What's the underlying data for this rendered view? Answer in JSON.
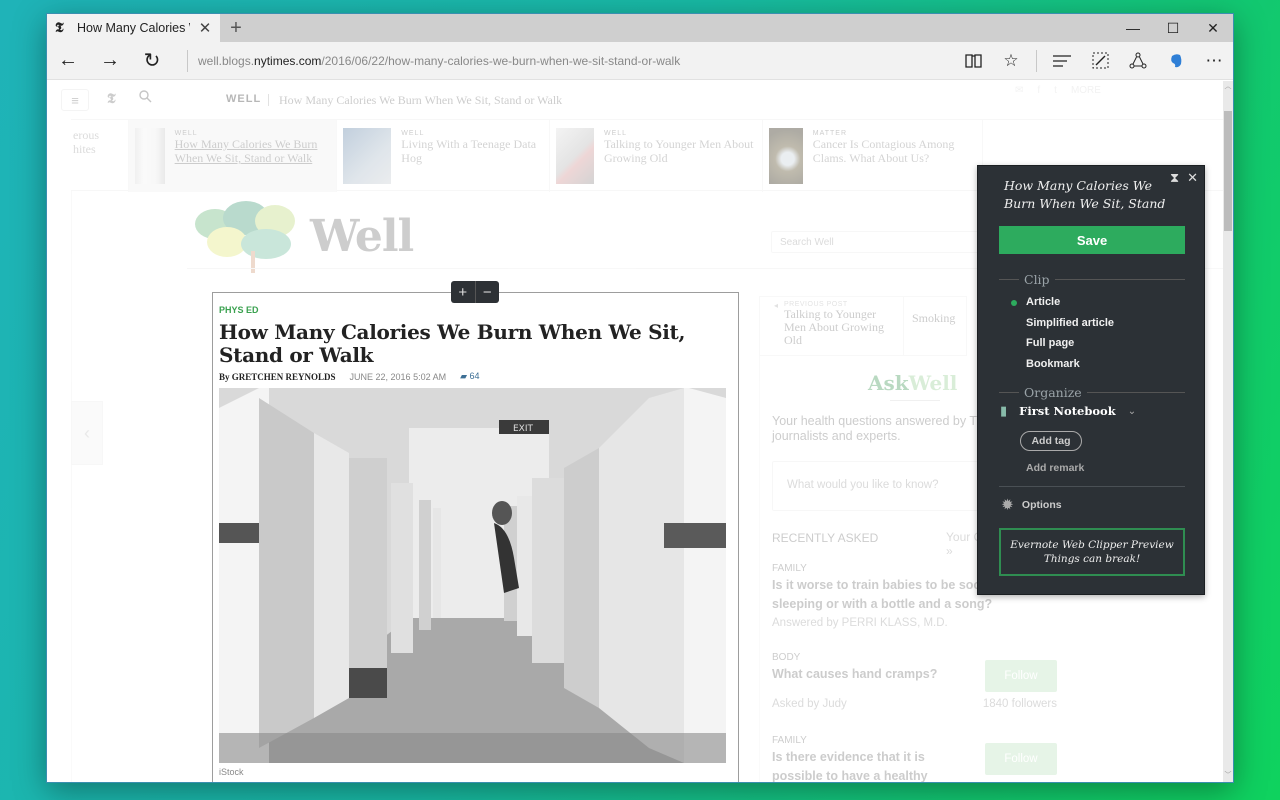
{
  "browser": {
    "tab_title": "How Many Calories We",
    "tab_favicon": "nyt-logo-icon",
    "new_tab": "+",
    "window_controls": {
      "minimize": "—",
      "maximize": "☐",
      "close": "✕"
    },
    "url": {
      "prefix": "well.blogs.",
      "domain": "nytimes.com",
      "path": "/2016/06/22/how-many-calories-we-burn-when-we-sit-stand-or-walk"
    },
    "nav": {
      "back": "←",
      "forward": "→",
      "refresh": "↻"
    },
    "toolbar": {
      "reading_view": "📖",
      "favorite": "☆",
      "hub": "≡",
      "web_note": "✎",
      "share": "⟁",
      "evernote": "🐘",
      "more": "⋯"
    }
  },
  "page": {
    "header": {
      "menu": "≡",
      "logo": "𝕿",
      "search": "🔍",
      "section": "WELL",
      "title": "How Many Calories We Burn When We Sit, Stand or Walk"
    },
    "ribbon": [
      {
        "kicker": "",
        "title": "erous\nhites",
        "current": false
      },
      {
        "kicker": "WELL",
        "title": "How Many Calories We Burn When We Sit, Stand or Walk",
        "current": true
      },
      {
        "kicker": "WELL",
        "title": "Living With a Teenage Data Hog",
        "current": false
      },
      {
        "kicker": "WELL",
        "title": "Talking to Younger Men About Growing Old",
        "current": false
      },
      {
        "kicker": "MATTER",
        "title": "Cancer Is Contagious Among Clams. What About Us?",
        "current": false
      }
    ],
    "share": {
      "more": "MORE"
    },
    "blog_logo": "Well",
    "search_placeholder": "Search Well",
    "prev_post": {
      "label": "PREVIOUS POST",
      "title": "Talking to Younger Men About Growing Old",
      "next_title": "Smoking"
    },
    "article": {
      "kicker": "PHYS ED",
      "title": "How Many Calories We Burn When We Sit, Stand or Walk",
      "byline": "By GRETCHEN REYNOLDS",
      "date": "JUNE 22, 2016 5:02 AM",
      "comments": "64",
      "photo_credit": "iStock",
      "photo_sign": "EXIT"
    },
    "zoom_controls": {
      "plus": "+",
      "minus": "−"
    },
    "askwell": {
      "logo_a": "Ask",
      "logo_b": "Well",
      "intro": "Your health questions answered by Times journalists and experts.",
      "ask_placeholder": "What would you like to know?",
      "recently_asked": "RECENTLY ASKED",
      "your_questions": "Your Questions | All »",
      "questions": [
        {
          "category": "FAMILY",
          "question": "Is it worse to train babies to be soothed by co-sleeping or with a bottle and a song?",
          "meta": "Answered by PERRI KLASS, M.D."
        },
        {
          "category": "BODY",
          "question": "What causes hand cramps?",
          "meta": "Asked by Judy",
          "follow": "Follow",
          "followers": "1840 followers"
        },
        {
          "category": "FAMILY",
          "question": "Is there evidence that it is possible to have a healthy",
          "follow": "Follow"
        }
      ]
    }
  },
  "clipper": {
    "title": "How Many Calories We Burn When We Sit, Stand",
    "save": "Save",
    "clip_heading": "Clip",
    "clip_options": [
      "Article",
      "Simplified article",
      "Full page",
      "Bookmark"
    ],
    "selected": "Article",
    "organize_heading": "Organize",
    "notebook": "First Notebook",
    "add_tag": "Add tag",
    "add_remark": "Add remark",
    "options": "Options",
    "preview_line1": "Evernote Web Clipper Preview",
    "preview_line2": "Things can break!",
    "accent": "#2dab5e"
  }
}
